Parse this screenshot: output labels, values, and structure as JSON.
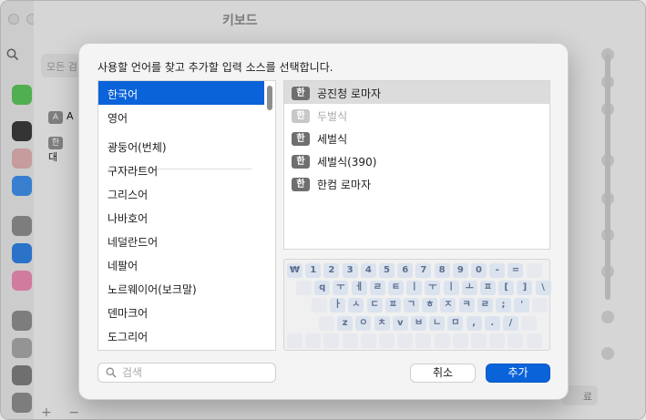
{
  "window": {
    "title": "키보드"
  },
  "background": {
    "search_placeholder": "모든 검",
    "left_rows": [
      {
        "badge": "A",
        "text": "A"
      },
      {
        "badge": "한",
        "text": "대"
      }
    ],
    "add_symbol": "+",
    "remove_symbol": "−",
    "bottom_button_fragment": "료"
  },
  "sheet": {
    "prompt": "사용할 언어를 찾고 추가할 입력 소스를 선택합니다.",
    "languages": [
      {
        "label": "한국어",
        "selected": true
      },
      {
        "label": "영어",
        "selected": false
      },
      {
        "label": "광둥어(번체)",
        "selected": false
      },
      {
        "label": "구자라트어",
        "selected": false
      },
      {
        "label": "그리스어",
        "selected": false
      },
      {
        "label": "나바호어",
        "selected": false
      },
      {
        "label": "네덜란드어",
        "selected": false
      },
      {
        "label": "네팔어",
        "selected": false
      },
      {
        "label": "노르웨이어(보크말)",
        "selected": false
      },
      {
        "label": "덴마크어",
        "selected": false
      },
      {
        "label": "도그리어",
        "selected": false
      }
    ],
    "input_sources": [
      {
        "badge": "한",
        "label": "공진청 로마자",
        "selected": true,
        "disabled": false
      },
      {
        "badge": "한",
        "label": "두벌식",
        "selected": false,
        "disabled": true
      },
      {
        "badge": "한",
        "label": "세벌식",
        "selected": false,
        "disabled": false
      },
      {
        "badge": "한",
        "label": "세벌식(390)",
        "selected": false,
        "disabled": false
      },
      {
        "badge": "한",
        "label": "한컴 로마자",
        "selected": false,
        "disabled": false
      }
    ],
    "keyboard_rows": [
      [
        "₩",
        "1",
        "2",
        "3",
        "4",
        "5",
        "6",
        "7",
        "8",
        "9",
        "0",
        "-",
        "=",
        ""
      ],
      [
        "",
        "q",
        "ㅜ",
        "ㅔ",
        "ㄹ",
        "ㅌ",
        "ㅣ",
        "ㅜ",
        "ㅣ",
        "ㅗ",
        "ㅍ",
        "[",
        "]",
        "\\"
      ],
      [
        "",
        "ㅏ",
        "ㅅ",
        "ㄷ",
        "ㅍ",
        "ㄱ",
        "ㅎ",
        "ㅈ",
        "ㅋ",
        "ㄹ",
        ";",
        "'",
        ""
      ],
      [
        "",
        "z",
        "ㅇ",
        "ㅊ",
        "v",
        "ㅂ",
        "ㄴ",
        "ㅁ",
        ",",
        ".",
        "/",
        ""
      ],
      [
        "",
        "",
        "",
        "",
        "",
        "",
        "",
        "",
        "",
        "",
        "",
        "",
        "",
        ""
      ]
    ],
    "search_placeholder": "검색",
    "cancel_label": "취소",
    "add_label": "추가"
  },
  "colors": {
    "accent": "#0a63d9",
    "selection_gray": "#dcdcdc",
    "key_fill": "#dbe3ef",
    "key_text": "#5d6f8f"
  },
  "icons": [
    "search-icon",
    "battery-icon",
    "lock-icon",
    "users-icon",
    "at-icon",
    "keyboard-icon",
    "mouse-icon"
  ]
}
